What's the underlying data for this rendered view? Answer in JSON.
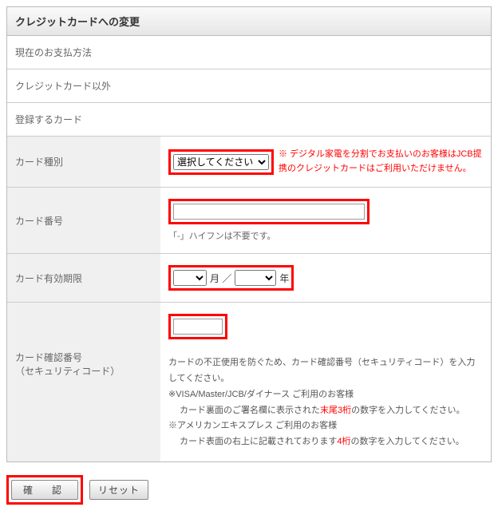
{
  "header": {
    "title": "クレジットカードへの変更"
  },
  "current": {
    "label": "現在のお支払方法",
    "value": "クレジットカード以外"
  },
  "register": {
    "label": "登録するカード"
  },
  "cardType": {
    "label": "カード種別",
    "placeholder": "選択してください",
    "warning": "※ デジタル家電を分割でお支払いのお客様はJCB提携のクレジットカードはご利用いただけません。"
  },
  "cardNumber": {
    "label": "カード番号",
    "hint": "「-」ハイフンは不要です。"
  },
  "expiry": {
    "label": "カード有効期限",
    "monthSuffix": "月 ／",
    "yearSuffix": "年"
  },
  "securityCode": {
    "label1": "カード確認番号",
    "label2": "（セキュリティコード）",
    "desc1": "カードの不正使用を防ぐため、カード確認番号（セキュリティコード）を入力してください。",
    "desc2": "※VISA/Master/JCB/ダイナース ご利用のお客様",
    "desc3a": "カード裏面のご署名欄に表示された",
    "desc3red": "末尾3桁",
    "desc3b": "の数字を入力してください。",
    "desc4": "※アメリカンエキスプレス ご利用のお客様",
    "desc5a": "カード表面の右上に記載されております",
    "desc5red": "4桁",
    "desc5b": "の数字を入力してください。"
  },
  "buttons": {
    "confirm": "確　認",
    "reset": "リセット"
  }
}
